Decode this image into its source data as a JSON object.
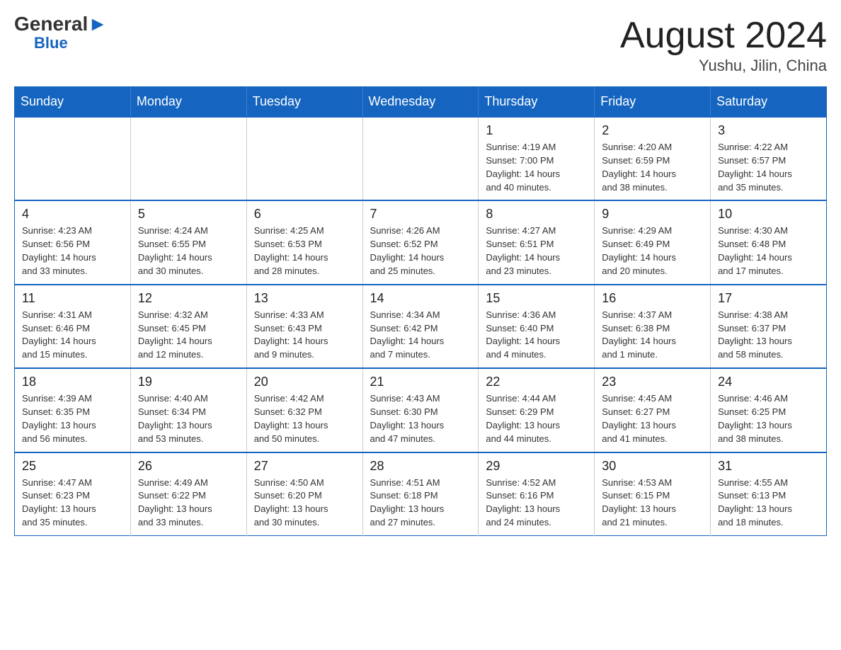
{
  "header": {
    "logo_general": "General",
    "logo_blue": "Blue",
    "title": "August 2024",
    "subtitle": "Yushu, Jilin, China"
  },
  "weekdays": [
    "Sunday",
    "Monday",
    "Tuesday",
    "Wednesday",
    "Thursday",
    "Friday",
    "Saturday"
  ],
  "weeks": [
    [
      {
        "day": "",
        "info": ""
      },
      {
        "day": "",
        "info": ""
      },
      {
        "day": "",
        "info": ""
      },
      {
        "day": "",
        "info": ""
      },
      {
        "day": "1",
        "info": "Sunrise: 4:19 AM\nSunset: 7:00 PM\nDaylight: 14 hours\nand 40 minutes."
      },
      {
        "day": "2",
        "info": "Sunrise: 4:20 AM\nSunset: 6:59 PM\nDaylight: 14 hours\nand 38 minutes."
      },
      {
        "day": "3",
        "info": "Sunrise: 4:22 AM\nSunset: 6:57 PM\nDaylight: 14 hours\nand 35 minutes."
      }
    ],
    [
      {
        "day": "4",
        "info": "Sunrise: 4:23 AM\nSunset: 6:56 PM\nDaylight: 14 hours\nand 33 minutes."
      },
      {
        "day": "5",
        "info": "Sunrise: 4:24 AM\nSunset: 6:55 PM\nDaylight: 14 hours\nand 30 minutes."
      },
      {
        "day": "6",
        "info": "Sunrise: 4:25 AM\nSunset: 6:53 PM\nDaylight: 14 hours\nand 28 minutes."
      },
      {
        "day": "7",
        "info": "Sunrise: 4:26 AM\nSunset: 6:52 PM\nDaylight: 14 hours\nand 25 minutes."
      },
      {
        "day": "8",
        "info": "Sunrise: 4:27 AM\nSunset: 6:51 PM\nDaylight: 14 hours\nand 23 minutes."
      },
      {
        "day": "9",
        "info": "Sunrise: 4:29 AM\nSunset: 6:49 PM\nDaylight: 14 hours\nand 20 minutes."
      },
      {
        "day": "10",
        "info": "Sunrise: 4:30 AM\nSunset: 6:48 PM\nDaylight: 14 hours\nand 17 minutes."
      }
    ],
    [
      {
        "day": "11",
        "info": "Sunrise: 4:31 AM\nSunset: 6:46 PM\nDaylight: 14 hours\nand 15 minutes."
      },
      {
        "day": "12",
        "info": "Sunrise: 4:32 AM\nSunset: 6:45 PM\nDaylight: 14 hours\nand 12 minutes."
      },
      {
        "day": "13",
        "info": "Sunrise: 4:33 AM\nSunset: 6:43 PM\nDaylight: 14 hours\nand 9 minutes."
      },
      {
        "day": "14",
        "info": "Sunrise: 4:34 AM\nSunset: 6:42 PM\nDaylight: 14 hours\nand 7 minutes."
      },
      {
        "day": "15",
        "info": "Sunrise: 4:36 AM\nSunset: 6:40 PM\nDaylight: 14 hours\nand 4 minutes."
      },
      {
        "day": "16",
        "info": "Sunrise: 4:37 AM\nSunset: 6:38 PM\nDaylight: 14 hours\nand 1 minute."
      },
      {
        "day": "17",
        "info": "Sunrise: 4:38 AM\nSunset: 6:37 PM\nDaylight: 13 hours\nand 58 minutes."
      }
    ],
    [
      {
        "day": "18",
        "info": "Sunrise: 4:39 AM\nSunset: 6:35 PM\nDaylight: 13 hours\nand 56 minutes."
      },
      {
        "day": "19",
        "info": "Sunrise: 4:40 AM\nSunset: 6:34 PM\nDaylight: 13 hours\nand 53 minutes."
      },
      {
        "day": "20",
        "info": "Sunrise: 4:42 AM\nSunset: 6:32 PM\nDaylight: 13 hours\nand 50 minutes."
      },
      {
        "day": "21",
        "info": "Sunrise: 4:43 AM\nSunset: 6:30 PM\nDaylight: 13 hours\nand 47 minutes."
      },
      {
        "day": "22",
        "info": "Sunrise: 4:44 AM\nSunset: 6:29 PM\nDaylight: 13 hours\nand 44 minutes."
      },
      {
        "day": "23",
        "info": "Sunrise: 4:45 AM\nSunset: 6:27 PM\nDaylight: 13 hours\nand 41 minutes."
      },
      {
        "day": "24",
        "info": "Sunrise: 4:46 AM\nSunset: 6:25 PM\nDaylight: 13 hours\nand 38 minutes."
      }
    ],
    [
      {
        "day": "25",
        "info": "Sunrise: 4:47 AM\nSunset: 6:23 PM\nDaylight: 13 hours\nand 35 minutes."
      },
      {
        "day": "26",
        "info": "Sunrise: 4:49 AM\nSunset: 6:22 PM\nDaylight: 13 hours\nand 33 minutes."
      },
      {
        "day": "27",
        "info": "Sunrise: 4:50 AM\nSunset: 6:20 PM\nDaylight: 13 hours\nand 30 minutes."
      },
      {
        "day": "28",
        "info": "Sunrise: 4:51 AM\nSunset: 6:18 PM\nDaylight: 13 hours\nand 27 minutes."
      },
      {
        "day": "29",
        "info": "Sunrise: 4:52 AM\nSunset: 6:16 PM\nDaylight: 13 hours\nand 24 minutes."
      },
      {
        "day": "30",
        "info": "Sunrise: 4:53 AM\nSunset: 6:15 PM\nDaylight: 13 hours\nand 21 minutes."
      },
      {
        "day": "31",
        "info": "Sunrise: 4:55 AM\nSunset: 6:13 PM\nDaylight: 13 hours\nand 18 minutes."
      }
    ]
  ]
}
